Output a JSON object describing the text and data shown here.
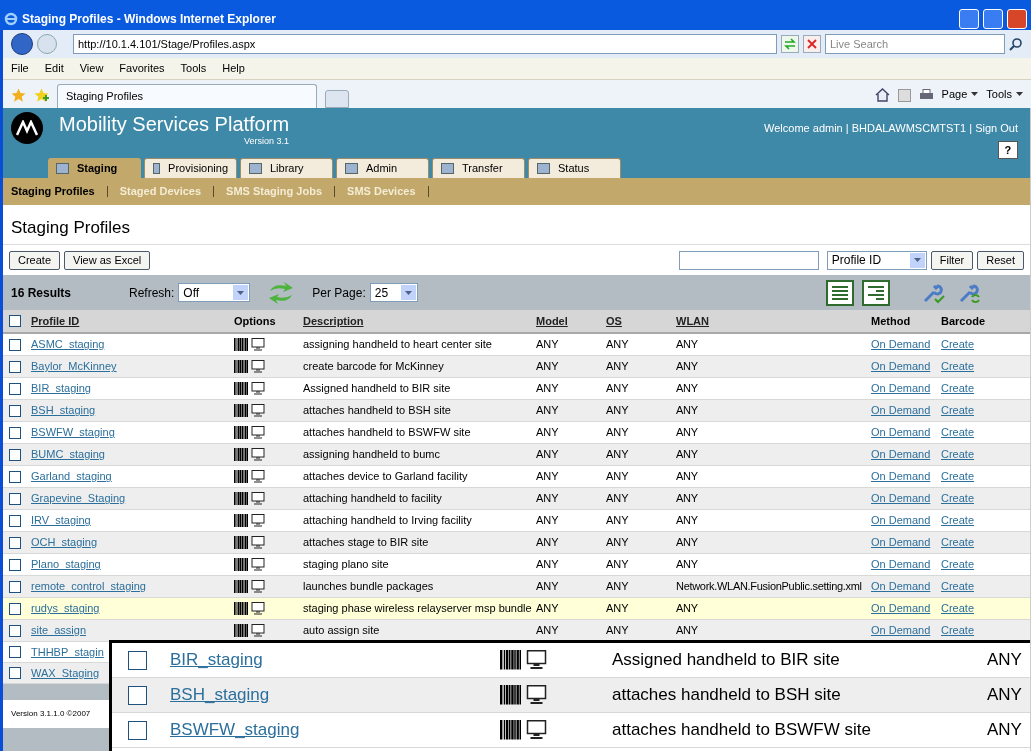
{
  "browser": {
    "title": "Staging Profiles - Windows Internet Explorer",
    "address": "http://10.1.4.101/Stage/Profiles.aspx",
    "search_placeholder": "Live Search",
    "menu": [
      "File",
      "Edit",
      "View",
      "Favorites",
      "Tools",
      "Help"
    ],
    "tab": "Staging Profiles",
    "commands": [
      "Page",
      "Tools"
    ]
  },
  "header": {
    "title": "Mobility Services Platform",
    "version": "Version 3.1",
    "welcome": "Welcome admin | BHDALAWMSCMTST1 | Sign Out",
    "help": "?"
  },
  "tabs": [
    {
      "label": "Staging",
      "selected": true
    },
    {
      "label": "Provisioning",
      "selected": false
    },
    {
      "label": "Library",
      "selected": false
    },
    {
      "label": "Admin",
      "selected": false
    },
    {
      "label": "Transfer",
      "selected": false
    },
    {
      "label": "Status",
      "selected": false
    }
  ],
  "subnav": [
    {
      "label": "Staging Profiles",
      "selected": true
    },
    {
      "label": "Staged Devices",
      "selected": false
    },
    {
      "label": "SMS Staging Jobs",
      "selected": false
    },
    {
      "label": "SMS Devices",
      "selected": false
    }
  ],
  "page_title": "Staging Profiles",
  "actions": [
    "Create",
    "View as Excel"
  ],
  "filter": {
    "field": "Profile ID",
    "buttons": [
      "Filter",
      "Reset"
    ]
  },
  "results": {
    "count": "16 Results",
    "refresh_label": "Refresh:",
    "refresh_value": "Off",
    "per_page_label": "Per Page:",
    "per_page_value": "25"
  },
  "select_all": {
    "checked": false
  },
  "columns": [
    {
      "label": "Profile ID",
      "sortable": true
    },
    {
      "label": "Options",
      "sortable": false
    },
    {
      "label": "Description",
      "sortable": true
    },
    {
      "label": "Model",
      "sortable": true
    },
    {
      "label": "OS",
      "sortable": true
    },
    {
      "label": "WLAN",
      "sortable": true
    },
    {
      "label": "Method",
      "sortable": false
    },
    {
      "label": "Barcode",
      "sortable": false
    }
  ],
  "rows": [
    {
      "profile_id": "ASMC_staging",
      "description": "assigning handheld to heart center site",
      "model": "ANY",
      "os": "ANY",
      "wlan": "ANY",
      "method": "On Demand",
      "barcode": "Create",
      "highlighted": false,
      "checked": false
    },
    {
      "profile_id": "Baylor_McKinney",
      "description": "create barcode for McKinney",
      "model": "ANY",
      "os": "ANY",
      "wlan": "ANY",
      "method": "On Demand",
      "barcode": "Create",
      "highlighted": false,
      "checked": false
    },
    {
      "profile_id": "BIR_staging",
      "description": "Assigned handheld to BIR site",
      "model": "ANY",
      "os": "ANY",
      "wlan": "ANY",
      "method": "On Demand",
      "barcode": "Create",
      "highlighted": false,
      "checked": false
    },
    {
      "profile_id": "BSH_staging",
      "description": "attaches handheld to BSH site",
      "model": "ANY",
      "os": "ANY",
      "wlan": "ANY",
      "method": "On Demand",
      "barcode": "Create",
      "highlighted": false,
      "checked": false
    },
    {
      "profile_id": "BSWFW_staging",
      "description": "attaches handheld to BSWFW site",
      "model": "ANY",
      "os": "ANY",
      "wlan": "ANY",
      "method": "On Demand",
      "barcode": "Create",
      "highlighted": false,
      "checked": false
    },
    {
      "profile_id": "BUMC_staging",
      "description": "assigning handheld to bumc",
      "model": "ANY",
      "os": "ANY",
      "wlan": "ANY",
      "method": "On Demand",
      "barcode": "Create",
      "highlighted": false,
      "checked": false
    },
    {
      "profile_id": "Garland_staging",
      "description": "attaches device to Garland facility",
      "model": "ANY",
      "os": "ANY",
      "wlan": "ANY",
      "method": "On Demand",
      "barcode": "Create",
      "highlighted": false,
      "checked": false
    },
    {
      "profile_id": "Grapevine_Staging",
      "description": "attaching handheld to facility",
      "model": "ANY",
      "os": "ANY",
      "wlan": "ANY",
      "method": "On Demand",
      "barcode": "Create",
      "highlighted": false,
      "checked": false
    },
    {
      "profile_id": "IRV_staging",
      "description": "attaching handheld to Irving facility",
      "model": "ANY",
      "os": "ANY",
      "wlan": "ANY",
      "method": "On Demand",
      "barcode": "Create",
      "highlighted": false,
      "checked": false
    },
    {
      "profile_id": "OCH_staging",
      "description": "attaches stage to BIR site",
      "model": "ANY",
      "os": "ANY",
      "wlan": "ANY",
      "method": "On Demand",
      "barcode": "Create",
      "highlighted": false,
      "checked": false
    },
    {
      "profile_id": "Plano_staging",
      "description": "staging plano site",
      "model": "ANY",
      "os": "ANY",
      "wlan": "ANY",
      "method": "On Demand",
      "barcode": "Create",
      "highlighted": false,
      "checked": false
    },
    {
      "profile_id": "remote_control_staging",
      "description": "launches bundle packages",
      "model": "ANY",
      "os": "ANY",
      "wlan": "Network.WLAN.FusionPublic.setting.xml",
      "method": "On Demand",
      "barcode": "Create",
      "highlighted": false,
      "checked": false
    },
    {
      "profile_id": "rudys_staging",
      "description": "staging phase wireless relayserver msp bundle",
      "model": "ANY",
      "os": "ANY",
      "wlan": "ANY",
      "method": "On Demand",
      "barcode": "Create",
      "highlighted": true,
      "checked": false
    },
    {
      "profile_id": "site_assign",
      "description": "auto assign site",
      "model": "ANY",
      "os": "ANY",
      "wlan": "ANY",
      "method": "On Demand",
      "barcode": "Create",
      "highlighted": false,
      "checked": false
    }
  ],
  "covered_rows": [
    {
      "profile_id": "THHBP_stagin",
      "checked": false
    },
    {
      "profile_id": "WAX_Staging",
      "checked": false
    }
  ],
  "footer": "Version 3.1.1.0 ©2007",
  "inset": {
    "rows": [
      {
        "profile_id": "BIR_staging",
        "description": "Assigned handheld to BIR site",
        "model": "ANY",
        "checked": false
      },
      {
        "profile_id": "BSH_staging",
        "description": "attaches handheld to BSH site",
        "model": "ANY",
        "checked": false
      },
      {
        "profile_id": "BSWFW_staging",
        "description": "attaches handheld to BSWFW site",
        "model": "ANY",
        "checked": false
      }
    ]
  }
}
